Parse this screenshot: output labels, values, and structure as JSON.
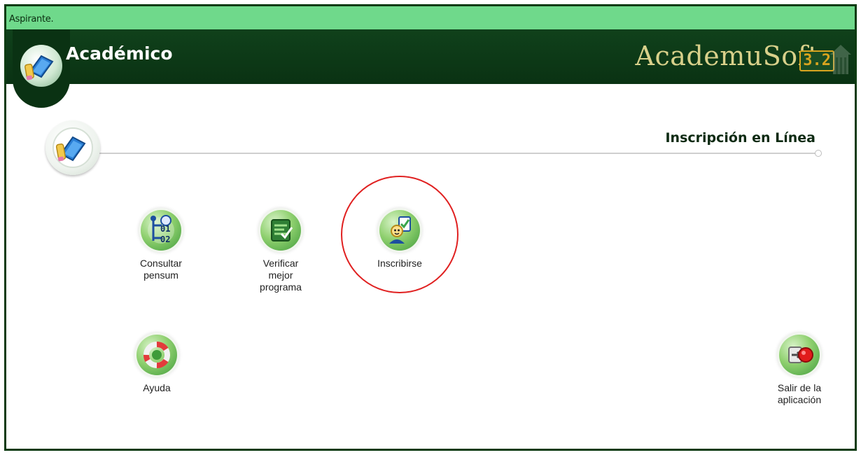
{
  "status_bar": {
    "text": "Aspirante."
  },
  "header": {
    "title": "Académico",
    "brand": "AcademuSoft",
    "brand_version": "3.2",
    "colors": {
      "header_bg": "#0a3213",
      "status_bg": "#6fd98b",
      "brand": "#d8d08a"
    }
  },
  "section": {
    "title": "Inscripción en Línea"
  },
  "menu": {
    "consultar": {
      "label": "Consultar\npensum",
      "icon": "flowchart-01-02-icon"
    },
    "verificar": {
      "label": "Verificar\nmejor\nprograma",
      "icon": "checklist-icon"
    },
    "inscribirse": {
      "label": "Inscribirse",
      "icon": "enroll-user-icon"
    },
    "ayuda": {
      "label": "Ayuda",
      "icon": "lifebuoy-icon"
    },
    "salir": {
      "label": "Salir de la\naplicación",
      "icon": "exit-icon"
    }
  },
  "highlight": {
    "target": "Inscribirse",
    "color": "#e02020"
  }
}
